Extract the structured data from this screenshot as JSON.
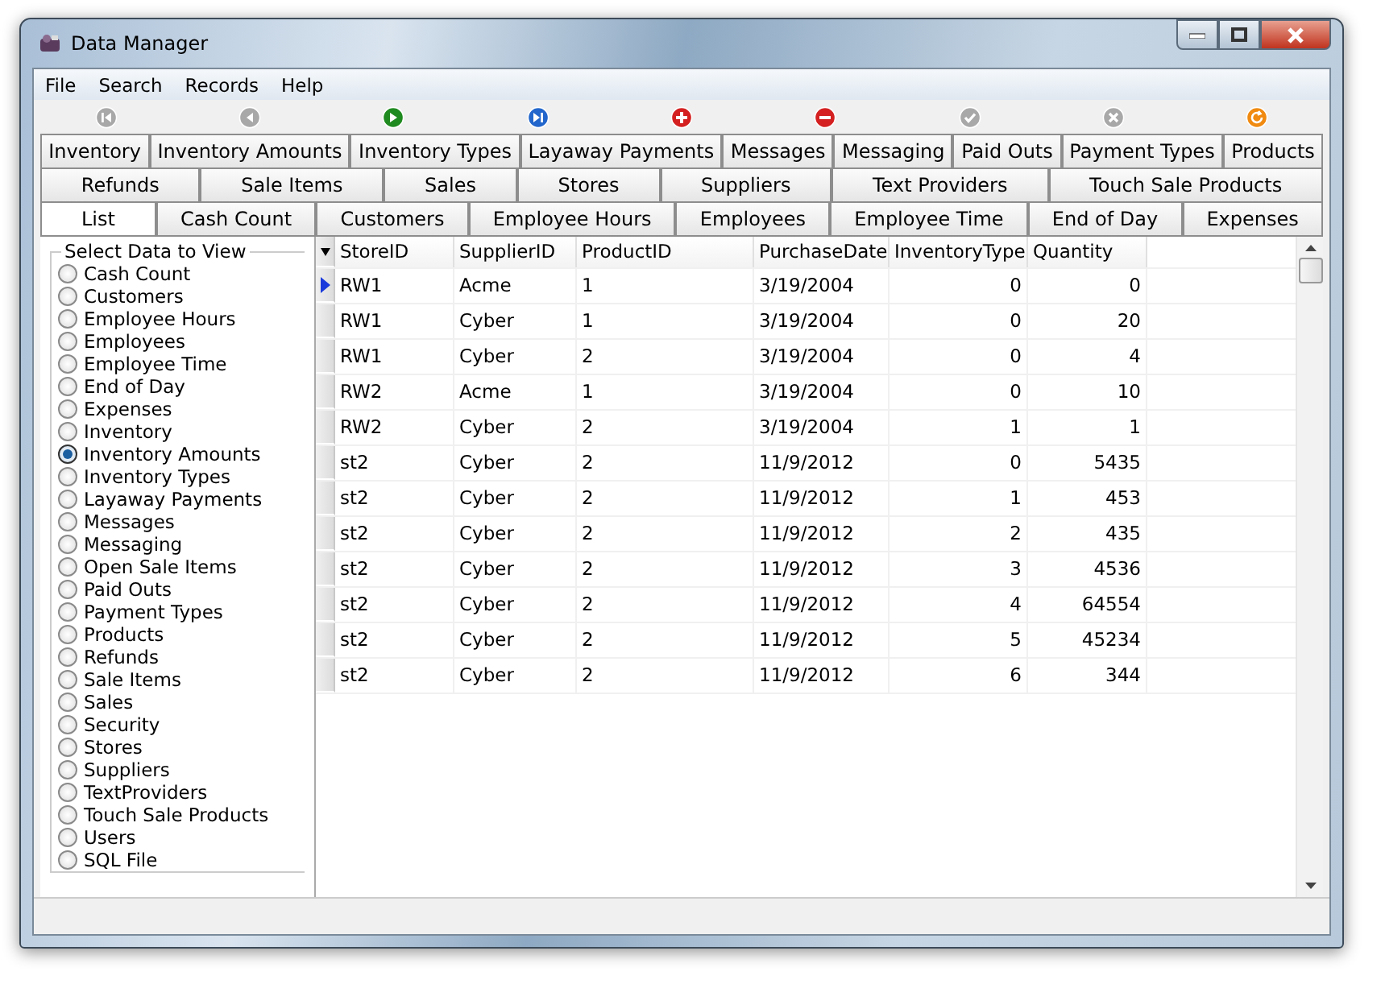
{
  "window": {
    "title": "Data Manager"
  },
  "menu": [
    "File",
    "Search",
    "Records",
    "Help"
  ],
  "toolbar": [
    {
      "kind": "first",
      "disabled": true
    },
    {
      "kind": "prior",
      "disabled": true
    },
    {
      "kind": "next",
      "disabled": false
    },
    {
      "kind": "last",
      "disabled": false
    },
    {
      "kind": "insert",
      "disabled": false
    },
    {
      "kind": "delete",
      "disabled": false
    },
    {
      "kind": "post",
      "disabled": true
    },
    {
      "kind": "cancel",
      "disabled": true
    },
    {
      "kind": "refresh",
      "disabled": false
    }
  ],
  "tab_rows": [
    [
      {
        "label": "Inventory",
        "selected": false
      },
      {
        "label": "Inventory Amounts",
        "selected": false
      },
      {
        "label": "Inventory Types",
        "selected": false
      },
      {
        "label": "Layaway Payments",
        "selected": false
      },
      {
        "label": "Messages",
        "selected": false
      },
      {
        "label": "Messaging",
        "selected": false
      },
      {
        "label": "Paid Outs",
        "selected": false
      },
      {
        "label": "Payment Types",
        "selected": false
      },
      {
        "label": "Products",
        "selected": false
      }
    ],
    [
      {
        "label": "Refunds",
        "selected": false
      },
      {
        "label": "Sale Items",
        "selected": false
      },
      {
        "label": "Sales",
        "selected": false
      },
      {
        "label": "Stores",
        "selected": false
      },
      {
        "label": "Suppliers",
        "selected": false
      },
      {
        "label": "Text Providers",
        "selected": false
      },
      {
        "label": "Touch Sale Products",
        "selected": false
      }
    ],
    [
      {
        "label": "List",
        "selected": true
      },
      {
        "label": "Cash Count",
        "selected": false
      },
      {
        "label": "Customers",
        "selected": false
      },
      {
        "label": "Employee Hours",
        "selected": false
      },
      {
        "label": "Employees",
        "selected": false
      },
      {
        "label": "Employee Time",
        "selected": false
      },
      {
        "label": "End of Day",
        "selected": false
      },
      {
        "label": "Expenses",
        "selected": false
      }
    ]
  ],
  "select_panel": {
    "title": "Select Data to View",
    "options": [
      {
        "label": "Cash Count",
        "selected": false
      },
      {
        "label": "Customers",
        "selected": false
      },
      {
        "label": "Employee Hours",
        "selected": false
      },
      {
        "label": "Employees",
        "selected": false
      },
      {
        "label": "Employee Time",
        "selected": false
      },
      {
        "label": "End of Day",
        "selected": false
      },
      {
        "label": "Expenses",
        "selected": false
      },
      {
        "label": "Inventory",
        "selected": false
      },
      {
        "label": "Inventory Amounts",
        "selected": true
      },
      {
        "label": "Inventory Types",
        "selected": false
      },
      {
        "label": "Layaway Payments",
        "selected": false
      },
      {
        "label": "Messages",
        "selected": false
      },
      {
        "label": "Messaging",
        "selected": false
      },
      {
        "label": "Open Sale Items",
        "selected": false
      },
      {
        "label": "Paid Outs",
        "selected": false
      },
      {
        "label": "Payment Types",
        "selected": false
      },
      {
        "label": "Products",
        "selected": false
      },
      {
        "label": "Refunds",
        "selected": false
      },
      {
        "label": "Sale Items",
        "selected": false
      },
      {
        "label": "Sales",
        "selected": false
      },
      {
        "label": "Security",
        "selected": false
      },
      {
        "label": "Stores",
        "selected": false
      },
      {
        "label": "Suppliers",
        "selected": false
      },
      {
        "label": "TextProviders",
        "selected": false
      },
      {
        "label": "Touch Sale Products",
        "selected": false
      },
      {
        "label": "Users",
        "selected": false
      },
      {
        "label": "SQL File",
        "selected": false
      }
    ]
  },
  "table": {
    "columns": [
      {
        "label": "StoreID",
        "kind": "text"
      },
      {
        "label": "SupplierID",
        "kind": "text"
      },
      {
        "label": "ProductID",
        "kind": "text"
      },
      {
        "label": "PurchaseDate",
        "kind": "text"
      },
      {
        "label": "InventoryType",
        "kind": "number"
      },
      {
        "label": "Quantity",
        "kind": "number"
      }
    ],
    "rows": [
      {
        "current": true,
        "cells": [
          "RW1",
          "Acme",
          "1",
          "3/19/2004",
          "0",
          "0"
        ]
      },
      {
        "current": false,
        "cells": [
          "RW1",
          "Cyber",
          "1",
          "3/19/2004",
          "0",
          "20"
        ]
      },
      {
        "current": false,
        "cells": [
          "RW1",
          "Cyber",
          "2",
          "3/19/2004",
          "0",
          "4"
        ]
      },
      {
        "current": false,
        "cells": [
          "RW2",
          "Acme",
          "1",
          "3/19/2004",
          "0",
          "10"
        ]
      },
      {
        "current": false,
        "cells": [
          "RW2",
          "Cyber",
          "2",
          "3/19/2004",
          "1",
          "1"
        ]
      },
      {
        "current": false,
        "cells": [
          "st2",
          "Cyber",
          "2",
          "11/9/2012",
          "0",
          "5435"
        ]
      },
      {
        "current": false,
        "cells": [
          "st2",
          "Cyber",
          "2",
          "11/9/2012",
          "1",
          "453"
        ]
      },
      {
        "current": false,
        "cells": [
          "st2",
          "Cyber",
          "2",
          "11/9/2012",
          "2",
          "435"
        ]
      },
      {
        "current": false,
        "cells": [
          "st2",
          "Cyber",
          "2",
          "11/9/2012",
          "3",
          "4536"
        ]
      },
      {
        "current": false,
        "cells": [
          "st2",
          "Cyber",
          "2",
          "11/9/2012",
          "4",
          "64554"
        ]
      },
      {
        "current": false,
        "cells": [
          "st2",
          "Cyber",
          "2",
          "11/9/2012",
          "5",
          "45234"
        ]
      },
      {
        "current": false,
        "cells": [
          "st2",
          "Cyber",
          "2",
          "11/9/2012",
          "6",
          "344"
        ]
      }
    ]
  }
}
